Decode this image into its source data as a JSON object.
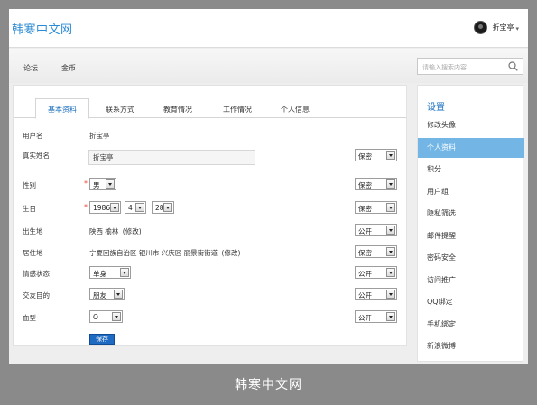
{
  "site": {
    "logo": "韩寒中文网",
    "caption": "韩寒中文网"
  },
  "user": {
    "name": "折宝亭",
    "caret": "▾"
  },
  "nav": {
    "items": [
      "论坛",
      "金币"
    ]
  },
  "search": {
    "placeholder": "请输入搜索内容"
  },
  "tabs": [
    "基本资料",
    "联系方式",
    "教育情况",
    "工作情况",
    "个人信息"
  ],
  "form": {
    "username": {
      "label": "用户名",
      "value": "折宝亭"
    },
    "realname": {
      "label": "真实姓名",
      "value": "折宝亭",
      "privacy": "保密"
    },
    "gender": {
      "label": "性别",
      "required": "*",
      "value": "男",
      "privacy": "保密"
    },
    "birthday": {
      "label": "生日",
      "required": "*",
      "year": "1986",
      "month": "4",
      "day": "28",
      "privacy": "保密"
    },
    "birthplace": {
      "label": "出生地",
      "value": "陕西 榆林",
      "edit": "(修改)",
      "privacy": "公开"
    },
    "residence": {
      "label": "居住地",
      "value": "宁夏回族自治区 银川市 兴庆区 丽景街街道",
      "edit": "(修改)",
      "privacy": "保密"
    },
    "relationship": {
      "label": "情感状态",
      "value": "单身",
      "privacy": "公开"
    },
    "purpose": {
      "label": "交友目的",
      "value": "朋友",
      "privacy": "公开"
    },
    "bloodtype": {
      "label": "血型",
      "value": "O",
      "privacy": "公开"
    },
    "save": "保存"
  },
  "sidebar": {
    "title": "设置",
    "items": [
      "修改头像",
      "个人资料",
      "积分",
      "用户组",
      "隐私筛选",
      "邮件提醒",
      "密码安全",
      "访问推广",
      "QQ绑定",
      "手机绑定",
      "新浪微博"
    ],
    "active": "个人资料"
  },
  "colors": {
    "accent": "#1a6fc0",
    "sidebar_active": "#73b6e6",
    "required": "#e43333"
  }
}
